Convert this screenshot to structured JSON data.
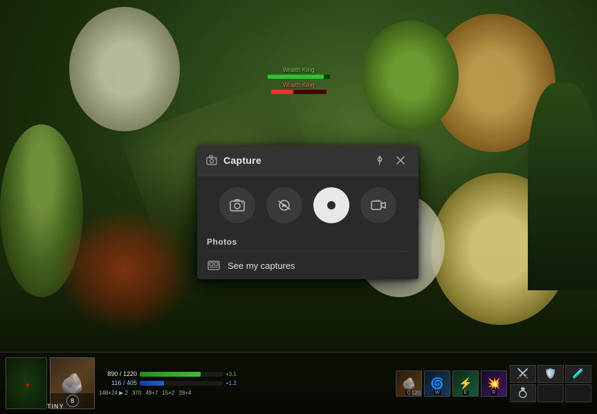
{
  "game": {
    "bg_description": "Dota 2 forest map",
    "hud": {
      "hero_name": "TINY",
      "hero_level": "8",
      "hp_current": "890",
      "hp_max": "1220",
      "hp_pct": 73,
      "mp_current": "116",
      "mp_max": "405",
      "mp_pct": 29,
      "hp_delta": "+3.1",
      "mp_delta": "+1.2",
      "stat_rows": [
        {
          "label": "148+24",
          "value": "2"
        },
        {
          "label": "370",
          "value": ""
        },
        {
          "label": "49+7",
          "value": ""
        },
        {
          "label": "15×2",
          "value": ""
        },
        {
          "label": "28+4",
          "value": ""
        }
      ]
    },
    "enemy": {
      "name": "Wraith King",
      "hp_pct": 40
    },
    "abilities": [
      {
        "key": "Q",
        "mana": 120,
        "class": "ability-q",
        "icon": "🪨"
      },
      {
        "key": "W",
        "mana": "",
        "class": "ability-w",
        "icon": "🌪"
      },
      {
        "key": "E",
        "mana": "",
        "class": "ability-e",
        "icon": "⚡"
      },
      {
        "key": "R",
        "mana": "",
        "class": "ability-r",
        "icon": "💥"
      }
    ]
  },
  "capture_modal": {
    "title": "Capture",
    "pin_tooltip": "Pin",
    "close_tooltip": "Close",
    "tools": [
      {
        "id": "screenshot",
        "label": "Screenshot",
        "icon": "camera"
      },
      {
        "id": "clip",
        "label": "Clip",
        "icon": "clip"
      },
      {
        "id": "record",
        "label": "Record",
        "icon": "record"
      },
      {
        "id": "facecam",
        "label": "FaceCam",
        "icon": "facecam"
      }
    ],
    "section_label": "Photos",
    "see_captures_label": "See my captures",
    "active_tool_index": 2
  }
}
